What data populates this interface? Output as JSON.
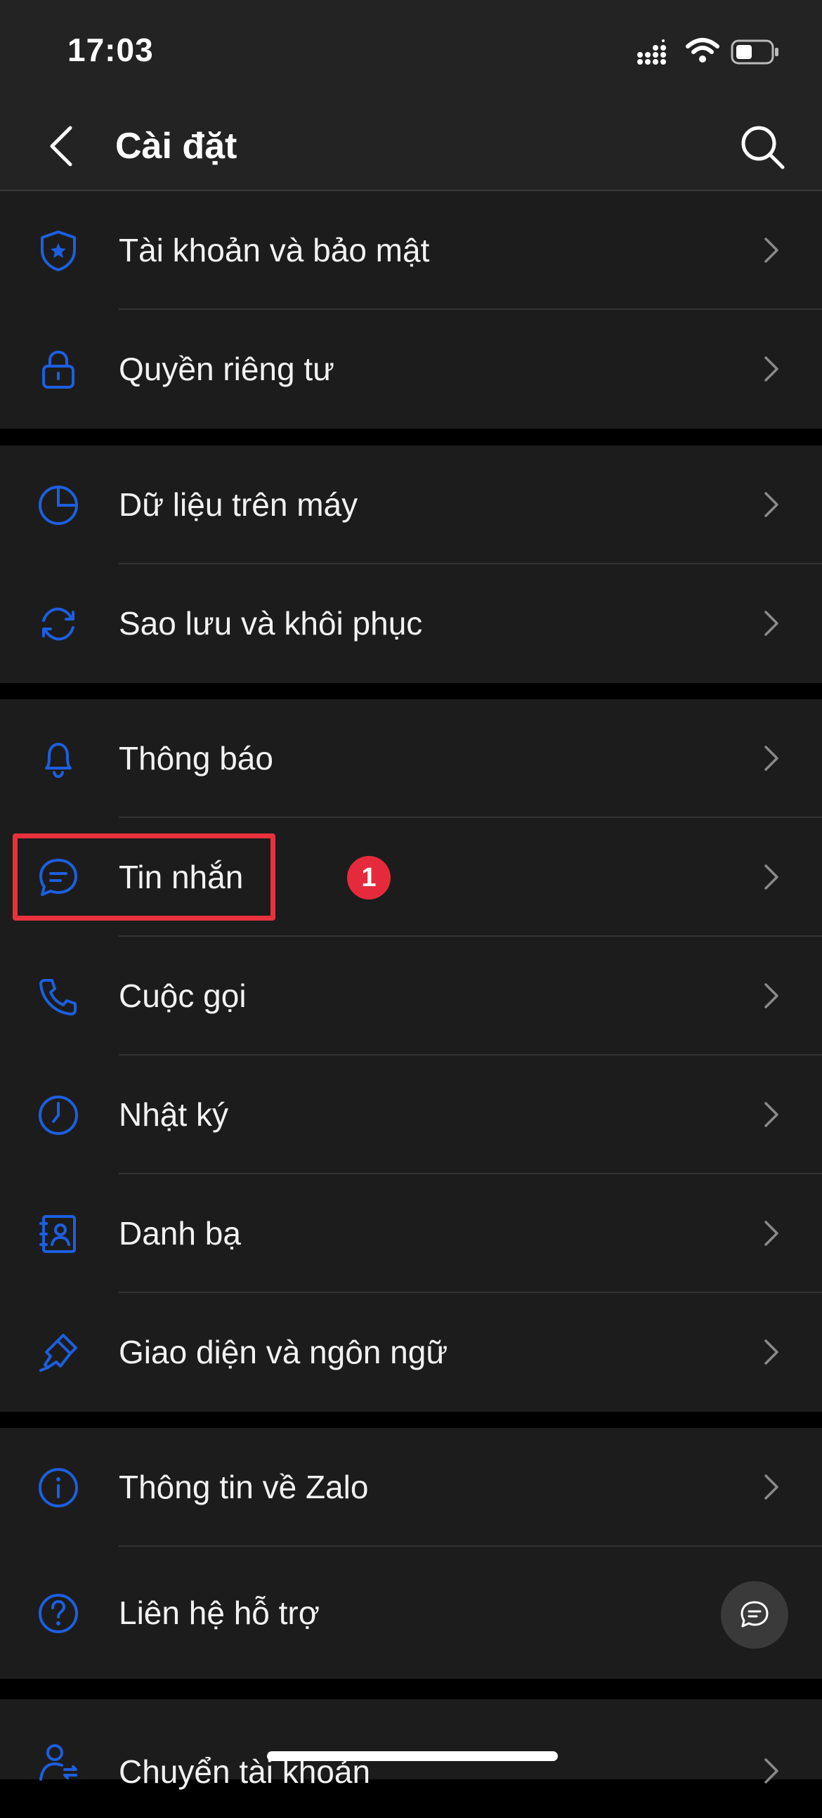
{
  "status_bar": {
    "time": "17:03"
  },
  "header": {
    "title": "Cài đặt"
  },
  "colors": {
    "accent": "#1d5fe0",
    "badge": "#e52b3b",
    "highlight": "#e8323d"
  },
  "groups": [
    {
      "items": [
        {
          "label": "Tài khoản và bảo mật",
          "icon": "shield-icon"
        },
        {
          "label": "Quyền riêng tư",
          "icon": "lock-icon"
        }
      ]
    },
    {
      "items": [
        {
          "label": "Dữ liệu trên máy",
          "icon": "pie-chart-icon"
        },
        {
          "label": "Sao lưu và khôi phục",
          "icon": "sync-icon"
        }
      ]
    },
    {
      "items": [
        {
          "label": "Thông báo",
          "icon": "bell-icon"
        },
        {
          "label": "Tin nhắn",
          "icon": "chat-bubble-icon",
          "badge": "1"
        },
        {
          "label": "Cuộc gọi",
          "icon": "phone-icon"
        },
        {
          "label": "Nhật ký",
          "icon": "clock-icon"
        },
        {
          "label": "Danh bạ",
          "icon": "contacts-icon"
        },
        {
          "label": "Giao diện và ngôn ngữ",
          "icon": "paintbrush-icon"
        }
      ]
    },
    {
      "items": [
        {
          "label": "Thông tin về Zalo",
          "icon": "info-icon"
        },
        {
          "label": "Liên hệ hỗ trợ",
          "icon": "help-icon"
        }
      ]
    },
    {
      "items": [
        {
          "label": "Chuyển tài khoản",
          "icon": "switch-account-icon"
        }
      ]
    }
  ]
}
